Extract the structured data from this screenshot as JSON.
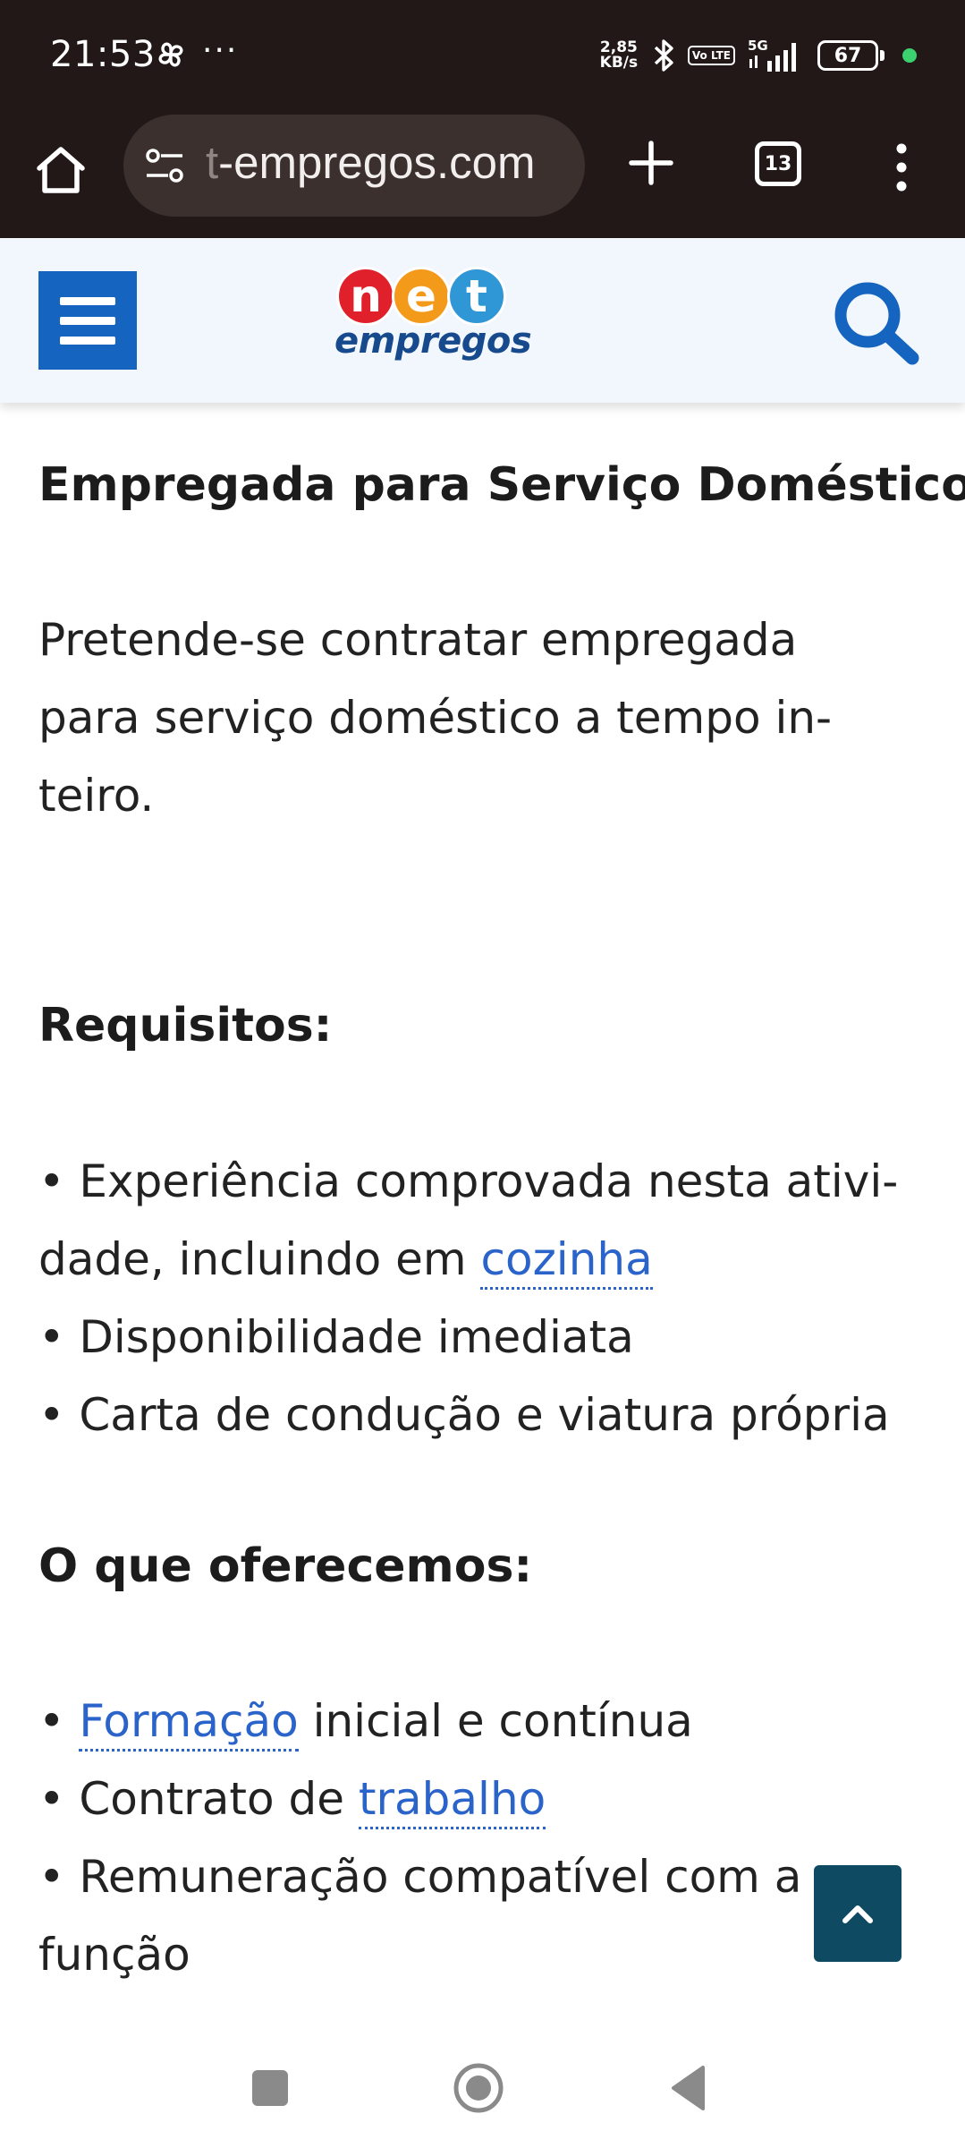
{
  "status_bar": {
    "time": "21:53",
    "dots": "···",
    "speed_top": "2,85",
    "speed_bottom": "KB/s",
    "volte_label": "Vo LTE",
    "network": "5G",
    "battery_level": "67",
    "icons": [
      "pinwheel-icon",
      "bluetooth-icon",
      "volte-icon",
      "signal-icon",
      "battery-icon",
      "privacy-dot-icon"
    ]
  },
  "browser": {
    "url_hidden_prefix": "t",
    "url_visible": "-empregos.com",
    "tab_count": "13",
    "icons": [
      "home-icon",
      "site-settings-icon",
      "new-tab-plus-icon",
      "tab-switcher-icon",
      "overflow-menu-icon"
    ]
  },
  "site": {
    "logo_letters": [
      "n",
      "e",
      "t"
    ],
    "logo_word": "empregos",
    "colors": {
      "menu_button": "#1565c0",
      "search_icon": "#1565c0",
      "logo_n": "#e0202a",
      "logo_e": "#f39a1b",
      "logo_t": "#2f97d6",
      "link": "#2a63c9",
      "back_to_top": "#0e4a62"
    },
    "icons": [
      "hamburger-menu-icon",
      "search-icon"
    ]
  },
  "article": {
    "title": "Empregada para Serviço Doméstico",
    "intro_lines": [
      "Pretende-se contratar empregada",
      "para serviço doméstico a tempo in-",
      "teiro."
    ],
    "requirements_heading": "Requisitos:",
    "requirements": {
      "item1_line1": "• Experiência comprovada nesta ativi-",
      "item1_line2_prefix": "dade, incluindo em ",
      "item1_link": "cozinha",
      "item2": "• Disponibilidade imediata",
      "item3": "• Carta de condução e viatura própria"
    },
    "offer_heading": "O que oferecemos:",
    "offers": {
      "item1_bullet": "• ",
      "item1_link": "Formação",
      "item1_suffix": " inicial e contínua",
      "item2_prefix": "• Contrato de ",
      "item2_link": "trabalho",
      "item3_line1": "• Remuneração compatível com a",
      "item3_line2": "função"
    }
  },
  "controls": {
    "back_to_top_icon": "chevron-up-icon",
    "nav_icons": [
      "recents-square-icon",
      "home-circle-icon",
      "back-triangle-icon"
    ]
  }
}
